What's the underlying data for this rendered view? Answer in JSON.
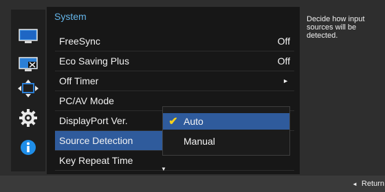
{
  "sidebar": {
    "icons": [
      "monitor-icon",
      "monitor-settings-icon",
      "resize-arrows-icon",
      "gear-icon",
      "info-icon"
    ]
  },
  "panel": {
    "title": "System",
    "items": [
      {
        "label": "FreeSync",
        "value": "Off"
      },
      {
        "label": "Eco Saving Plus",
        "value": "Off"
      },
      {
        "label": "Off Timer",
        "value": "►"
      },
      {
        "label": "PC/AV Mode",
        "value": ""
      },
      {
        "label": "DisplayPort Ver.",
        "value": ""
      },
      {
        "label": "Source Detection",
        "value": ""
      },
      {
        "label": "Key Repeat Time",
        "value": ""
      }
    ],
    "scroll_indicator": "▼"
  },
  "submenu": {
    "options": [
      "Auto",
      "Manual"
    ],
    "selected": "Auto",
    "check_glyph": "✔"
  },
  "help": {
    "text": "Decide how input sources will be detected."
  },
  "footer": {
    "return_glyph": "◄",
    "return_label": "Return"
  },
  "colors": {
    "accent_blue": "#65b6ea",
    "selection": "#2f5b9c",
    "check": "#f7d21a"
  }
}
